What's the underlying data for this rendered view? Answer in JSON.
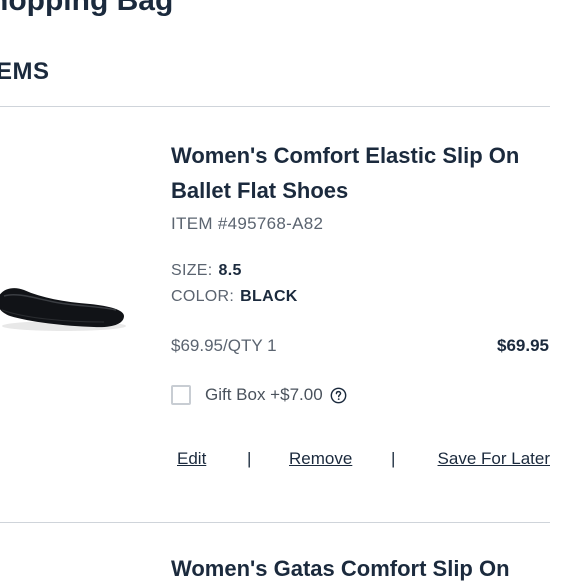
{
  "page": {
    "title": "hopping Bag",
    "section_label": "EMS"
  },
  "item": {
    "name": "Women's Comfort Elastic Slip On Ballet Flat Shoes",
    "item_number": "ITEM #495768-A82",
    "size_label": "SIZE:",
    "size_value": "8.5",
    "color_label": "COLOR:",
    "color_value": "BLACK",
    "unit_price": "$69.95/QTY 1",
    "line_total": "$69.95",
    "gift_box_label": "Gift Box +$7.00",
    "gift_box_checked": false,
    "help_icon": "question-circle-icon",
    "image_icon": "ballet-flat-shoe-image"
  },
  "actions": {
    "edit": "Edit",
    "separator": "|",
    "remove": "Remove",
    "save_for_later": "Save For Later"
  },
  "next_item": {
    "name": "Women's Gatas Comfort Slip On"
  }
}
